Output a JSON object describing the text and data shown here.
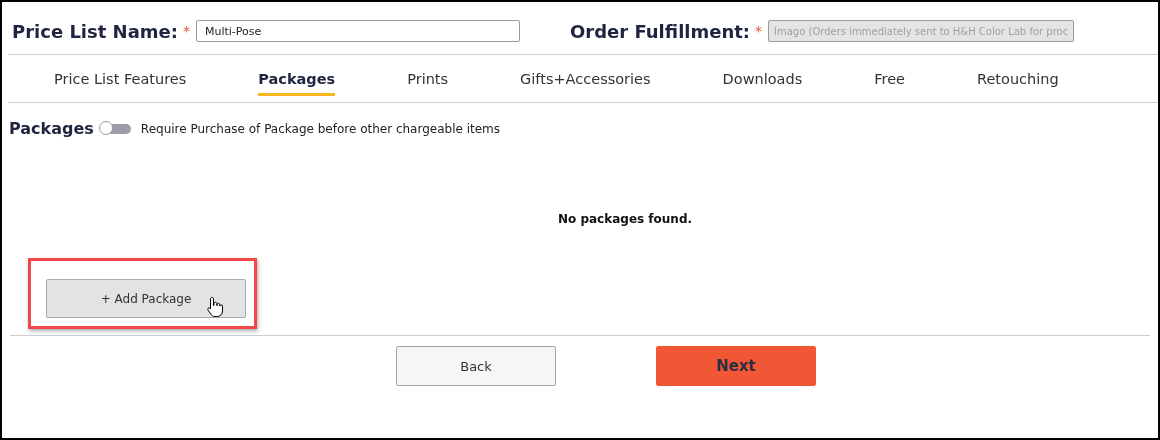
{
  "header": {
    "fields": [
      {
        "label": "Price List Name:",
        "required_mark": "*",
        "value": "Multi-Pose",
        "disabled": false
      },
      {
        "label": "Order Fulfillment:",
        "required_mark": "*",
        "value": "Imago (Orders immediately sent to H&H Color Lab for proc",
        "disabled": true
      }
    ]
  },
  "tabs": [
    {
      "label": "Price List Features",
      "selected": false
    },
    {
      "label": "Packages",
      "selected": true
    },
    {
      "label": "Prints",
      "selected": false
    },
    {
      "label": "Gifts+Accessories",
      "selected": false
    },
    {
      "label": "Downloads",
      "selected": false
    },
    {
      "label": "Free",
      "selected": false
    },
    {
      "label": "Retouching",
      "selected": false
    }
  ],
  "packages": {
    "title": "Packages",
    "toggle": {
      "on": false,
      "label": "Require Purchase of Package before other chargeable items"
    },
    "empty_message": "No packages found.",
    "add_button": {
      "label": "+ Add Package",
      "highlighted": true
    }
  },
  "footer_buttons": [
    {
      "label": "Back",
      "kind": "secondary"
    },
    {
      "label": "Next",
      "kind": "primary"
    }
  ]
}
